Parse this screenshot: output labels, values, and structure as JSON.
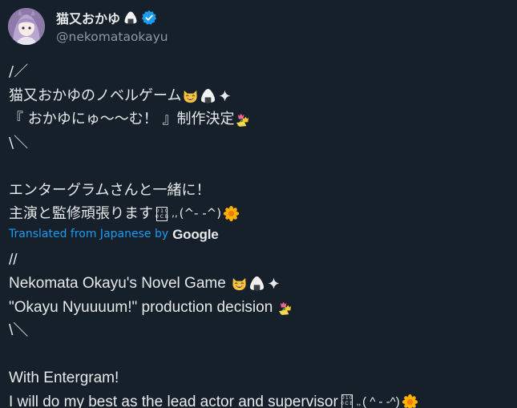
{
  "author": {
    "display_name": "猫又おかゆ",
    "name_emoji_icon": "onigiri-icon",
    "verified_icon": "verified-badge-icon",
    "handle": "@nekomataokayu",
    "avatar": "avatar"
  },
  "tweet": {
    "original": {
      "l1": "/／",
      "l2": "猫又おかゆのノベルゲーム",
      "l3": "『 おかゆにゅ～～む！ 』制作決定",
      "l4": "\\＼",
      "l5": "エンターグラムさんと一緒に！",
      "l6a": "主演と監修頑張ります",
      "l6b": "‚‚",
      "l6c": "(^- -^)"
    },
    "translated_label": "Translated from Japanese by",
    "translator": "Google",
    "translation": {
      "l1": "//",
      "l2": "Nekomata Okayu's Novel Game",
      "l3": "\"Okayu Nyuuuum!\" production decision",
      "l4": "\\＼",
      "l5": "With Entergram!",
      "l6a": "I will do my best as the lead actor and supervisor",
      "l6b": "‚‚",
      "l6c": "( ^ - -^)"
    },
    "box_glyph": {
      "top": "0 1 0",
      "bottom": "0 C B"
    }
  },
  "colors": {
    "background": "#15202b",
    "text": "#e7e9ea",
    "secondary": "#8b98a5",
    "accent": "#1d9bf0"
  },
  "emoji_icons": [
    "smiling-cat-icon",
    "onigiri-icon",
    "sparkle-icon",
    "tulip-bouquet-icon",
    "blossom-icon"
  ]
}
